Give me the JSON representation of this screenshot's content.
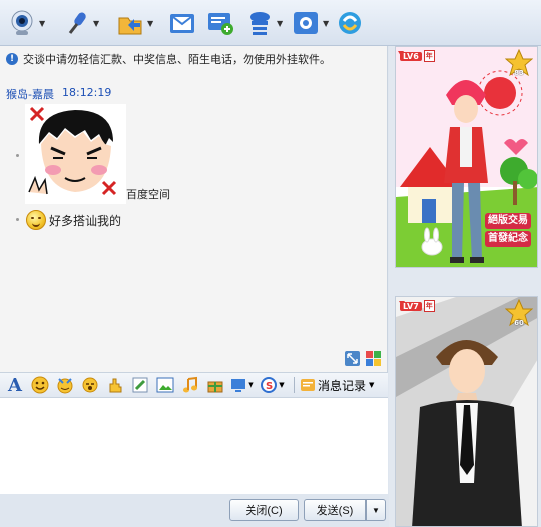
{
  "toolbar": {
    "items": [
      {
        "icon": "video-icon",
        "has_menu": true
      },
      {
        "icon": "microphone-icon",
        "has_menu": true
      },
      {
        "icon": "send-file-icon",
        "has_menu": true
      },
      {
        "icon": "email-icon",
        "has_menu": false
      },
      {
        "icon": "sms-icon",
        "has_menu": false
      },
      {
        "icon": "profile-icon",
        "has_menu": true
      },
      {
        "icon": "app-icon",
        "has_menu": true
      },
      {
        "icon": "remote-icon",
        "has_menu": false
      }
    ]
  },
  "chat": {
    "notice": "交谈中请勿轻信汇款、中奖信息、陌生电话，勿使用外挂软件。",
    "messages": {
      "sender": "猴岛-嘉晨",
      "time": "18:12:19",
      "sticker_caption": "百度空间",
      "text": "好多搭讪我的"
    }
  },
  "format_toolbar": {
    "history_label": "消息记录"
  },
  "buttons": {
    "close_label": "关闭(C)",
    "send_label": "发送(S)"
  },
  "show": {
    "top": {
      "level": "LV6",
      "year": "年",
      "score": "83",
      "banner_line1": "絕版交易",
      "banner_line2": "首發紀念"
    },
    "bottom": {
      "level": "LV7",
      "year": "年",
      "score": "60"
    }
  },
  "colors": {
    "accent": "#1c4fb5",
    "badge": "#e23636"
  }
}
